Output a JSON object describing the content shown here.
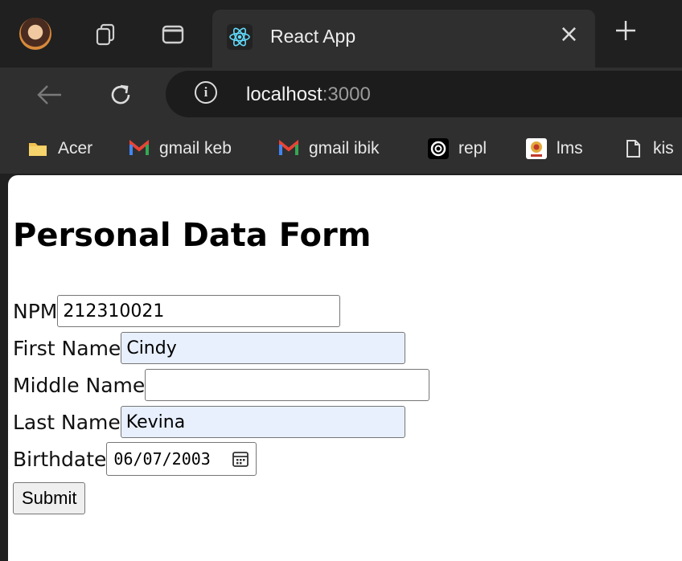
{
  "browser": {
    "tab_title": "React App",
    "tab_close": "×",
    "url_host": "localhost",
    "url_port": ":3000",
    "info_glyph": "i"
  },
  "bookmarks": [
    {
      "label": "Acer",
      "icon": "folder-icon"
    },
    {
      "label": "gmail keb",
      "icon": "gmail-icon"
    },
    {
      "label": "gmail ibik",
      "icon": "gmail-icon"
    },
    {
      "label": "repl",
      "icon": "replit-icon"
    },
    {
      "label": "lms",
      "icon": "lms-icon"
    },
    {
      "label": "kis",
      "icon": "page-icon"
    }
  ],
  "form": {
    "title": "Personal Data Form",
    "npm_label": "NPM",
    "npm_value": "212310021",
    "first_name_label": "First Name",
    "first_name_value": "Cindy",
    "middle_name_label": "Middle Name",
    "middle_name_value": "",
    "last_name_label": "Last Name",
    "last_name_value": "Kevina",
    "birthdate_label": "Birthdate",
    "birthdate_value": "06/07/2003",
    "submit_label": "Submit"
  },
  "colors": {
    "browser_bg": "#202020",
    "toolbar_bg": "#2f2f2f",
    "autofill_bg": "#e8f0fe"
  }
}
